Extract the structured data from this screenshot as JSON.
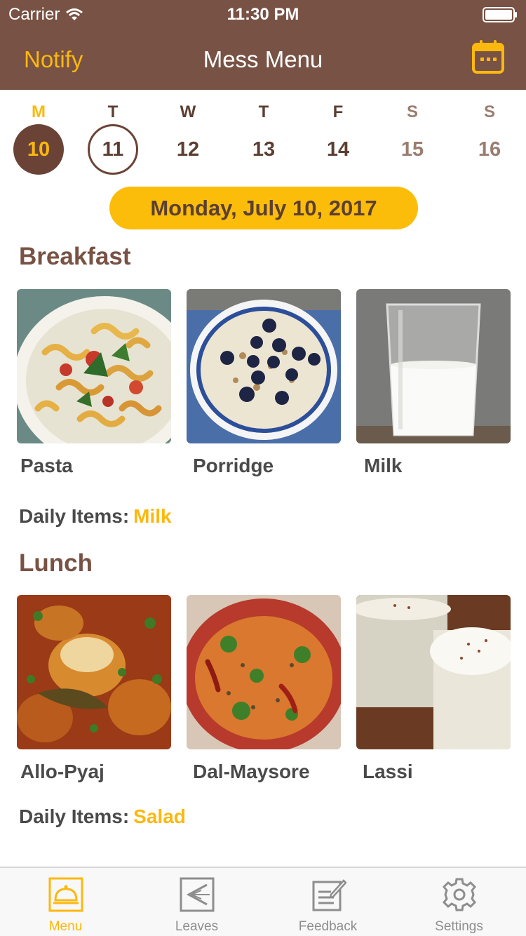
{
  "status_bar": {
    "carrier": "Carrier",
    "time": "11:30 PM"
  },
  "nav": {
    "left_label": "Notify",
    "title": "Mess Menu",
    "right_icon": "calendar-icon"
  },
  "week": [
    {
      "letter": "M",
      "date": "10",
      "state": "selected"
    },
    {
      "letter": "T",
      "date": "11",
      "state": "today"
    },
    {
      "letter": "W",
      "date": "12",
      "state": "normal"
    },
    {
      "letter": "T",
      "date": "13",
      "state": "normal"
    },
    {
      "letter": "F",
      "date": "14",
      "state": "normal"
    },
    {
      "letter": "S",
      "date": "15",
      "state": "weekend"
    },
    {
      "letter": "S",
      "date": "16",
      "state": "weekend"
    }
  ],
  "selected_date_label": "Monday, July 10, 2017",
  "meals": [
    {
      "title": "Breakfast",
      "items": [
        {
          "name": "Pasta",
          "image": "pasta-photo"
        },
        {
          "name": "Porridge",
          "image": "porridge-photo"
        },
        {
          "name": "Milk",
          "image": "milk-photo"
        }
      ],
      "daily_label": "Daily Items:",
      "daily_value": "Milk"
    },
    {
      "title": "Lunch",
      "items": [
        {
          "name": "Allo-Pyaj",
          "image": "aloo-pyaj-photo"
        },
        {
          "name": "Dal-Maysore",
          "image": "dal-photo"
        },
        {
          "name": "Lassi",
          "image": "lassi-photo"
        }
      ],
      "daily_label": "Daily Items:",
      "daily_value": "Salad"
    }
  ],
  "tabs": [
    {
      "label": "Menu",
      "icon": "cloche-icon",
      "active": true
    },
    {
      "label": "Leaves",
      "icon": "leave-arrow-icon",
      "active": false
    },
    {
      "label": "Feedback",
      "icon": "feedback-icon",
      "active": false
    },
    {
      "label": "Settings",
      "icon": "gear-icon",
      "active": false
    }
  ],
  "colors": {
    "brand_brown": "#785244",
    "accent_yellow": "#fbb80f",
    "text_dark": "#4a4a4a"
  }
}
